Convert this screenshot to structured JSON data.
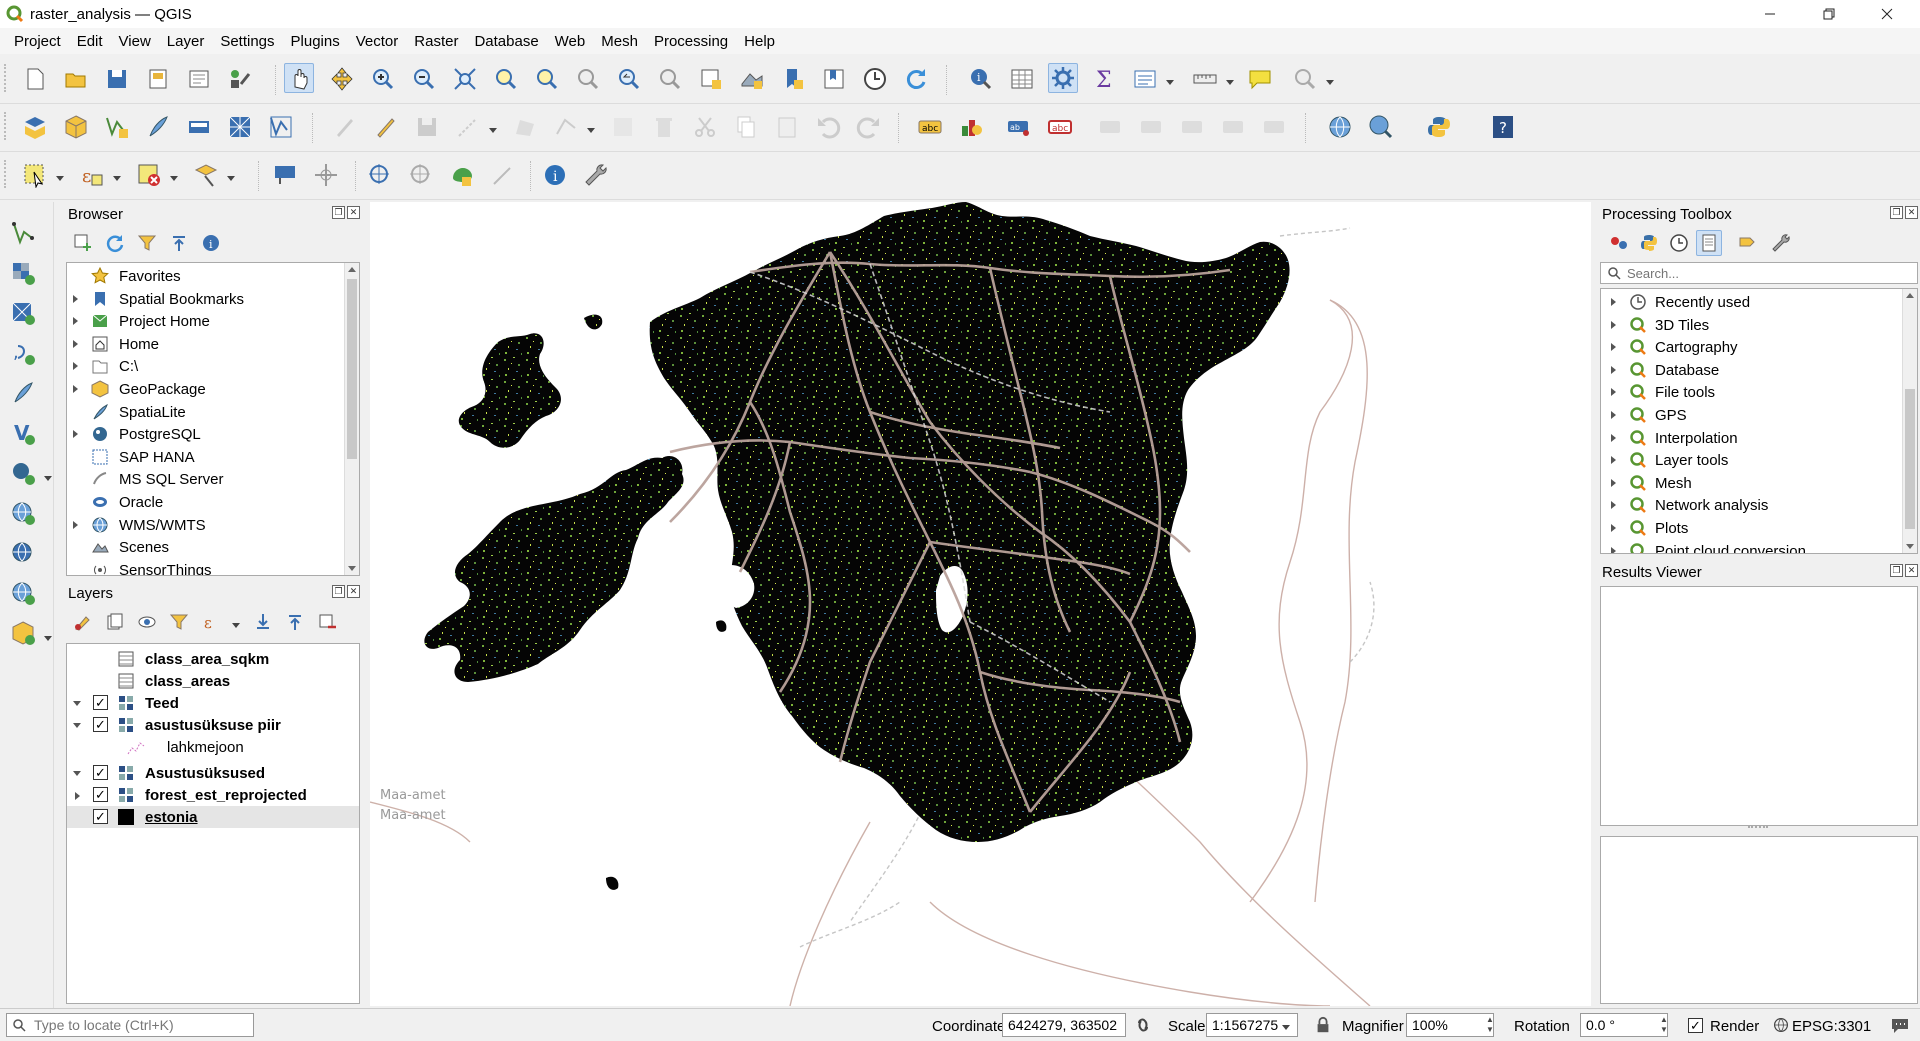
{
  "window": {
    "title": "raster_analysis — QGIS",
    "controls": [
      "minimize",
      "restore",
      "close"
    ]
  },
  "menu": [
    "Project",
    "Edit",
    "View",
    "Layer",
    "Settings",
    "Plugins",
    "Vector",
    "Raster",
    "Database",
    "Web",
    "Mesh",
    "Processing",
    "Help"
  ],
  "browser": {
    "title": "Browser",
    "items": [
      {
        "label": "Favorites",
        "icon": "star-icon",
        "expandable": false
      },
      {
        "label": "Spatial Bookmarks",
        "icon": "bookmark-icon",
        "expandable": true
      },
      {
        "label": "Project Home",
        "icon": "project-home-icon",
        "expandable": true
      },
      {
        "label": "Home",
        "icon": "home-icon",
        "expandable": true
      },
      {
        "label": "C:\\",
        "icon": "drive-icon",
        "expandable": true
      },
      {
        "label": "GeoPackage",
        "icon": "geopackage-icon",
        "expandable": true
      },
      {
        "label": "SpatiaLite",
        "icon": "spatialite-icon",
        "expandable": false
      },
      {
        "label": "PostgreSQL",
        "icon": "postgresql-icon",
        "expandable": true
      },
      {
        "label": "SAP HANA",
        "icon": "sap-hana-icon",
        "expandable": false
      },
      {
        "label": "MS SQL Server",
        "icon": "mssql-icon",
        "expandable": false
      },
      {
        "label": "Oracle",
        "icon": "oracle-icon",
        "expandable": false
      },
      {
        "label": "WMS/WMTS",
        "icon": "wms-icon",
        "expandable": true
      },
      {
        "label": "Scenes",
        "icon": "scenes-icon",
        "expandable": false
      },
      {
        "label": "SensorThings",
        "icon": "sensorthings-icon",
        "expandable": false
      }
    ]
  },
  "layers": {
    "title": "Layers",
    "items": [
      {
        "label": "class_area_sqkm",
        "type": "table",
        "checked": null,
        "expand": null,
        "indent": 0,
        "underline": false
      },
      {
        "label": "class_areas",
        "type": "table",
        "checked": null,
        "expand": null,
        "indent": 0,
        "underline": false
      },
      {
        "label": "Teed",
        "type": "group",
        "checked": true,
        "expand": "down",
        "indent": 0,
        "underline": false
      },
      {
        "label": "asustusüksuse piir",
        "type": "group",
        "checked": true,
        "expand": "down",
        "indent": 0,
        "underline": false
      },
      {
        "label": "lahkmejoon",
        "type": "line",
        "checked": null,
        "expand": null,
        "indent": 1,
        "underline": false
      },
      {
        "label": "Asustusüksused",
        "type": "group",
        "checked": true,
        "expand": "down",
        "indent": 0,
        "underline": false
      },
      {
        "label": "forest_est_reprojected",
        "type": "group",
        "checked": true,
        "expand": "right",
        "indent": 0,
        "underline": false
      },
      {
        "label": "estonia",
        "type": "raster",
        "checked": true,
        "expand": null,
        "indent": 0,
        "underline": true
      }
    ]
  },
  "toolbox": {
    "title": "Processing Toolbox",
    "search_placeholder": "Search...",
    "items": [
      "Recently used",
      "3D Tiles",
      "Cartography",
      "Database",
      "File tools",
      "GPS",
      "Interpolation",
      "Layer tools",
      "Mesh",
      "Network analysis",
      "Plots",
      "Point cloud conversion"
    ]
  },
  "results": {
    "title": "Results Viewer"
  },
  "map": {
    "attribution": "Maa-amet",
    "colors": {
      "land": "#050505",
      "roads": "#b29a94",
      "forest_dots": "#7fb53a"
    }
  },
  "status": {
    "locate_placeholder": "Type to locate (Ctrl+K)",
    "coordinate_label": "Coordinate",
    "coordinate_value": "6424279, 363502",
    "scale_label": "Scale",
    "scale_value": "1:1567275",
    "magnifier_label": "Magnifier",
    "magnifier_value": "100%",
    "rotation_label": "Rotation",
    "rotation_value": "0.0 °",
    "render_label": "Render",
    "render_checked": true,
    "crs": "EPSG:3301"
  }
}
